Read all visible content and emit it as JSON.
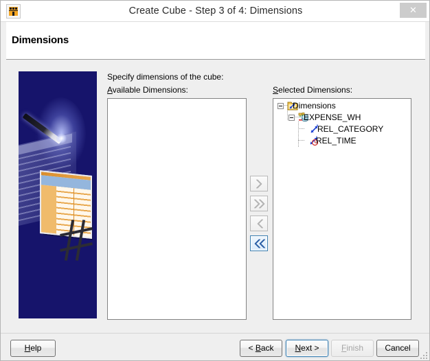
{
  "window": {
    "title": "Create Cube - Step 3 of 4: Dimensions",
    "app_icon": "cube-wizard-icon",
    "close_label": "✕"
  },
  "header": {
    "title": "Dimensions"
  },
  "main": {
    "instruction": "Specify dimensions of the cube:",
    "available_label_prefix": "A",
    "available_label_rest": "vailable Dimensions:",
    "selected_label_prefix": "S",
    "selected_label_rest": "elected Dimensions:",
    "available_items": []
  },
  "tree": {
    "root": {
      "label": "Dimensions",
      "icon": "folder-link-icon",
      "expanded": true
    },
    "cube": {
      "label": "EXPENSE_WH",
      "icon": "cube-database-icon",
      "expanded": true
    },
    "children": [
      {
        "label": "REL_CATEGORY",
        "icon": "relation-arrows-icon"
      },
      {
        "label": "REL_TIME",
        "icon": "relation-time-icon"
      }
    ]
  },
  "transfer_buttons": [
    {
      "name": "move-right-button",
      "glyph": "›",
      "enabled": false
    },
    {
      "name": "move-all-right-button",
      "glyph": "»",
      "enabled": false
    },
    {
      "name": "move-left-button",
      "glyph": "‹",
      "enabled": false
    },
    {
      "name": "move-all-left-button",
      "glyph": "«",
      "enabled": true
    }
  ],
  "footer": {
    "help": {
      "prefix": "H",
      "mnemonic": "",
      "text_before": "",
      "label_a": "H",
      "label_b": "elp"
    },
    "back": {
      "label_a": "< ",
      "label_b": "B",
      "label_c": "ack"
    },
    "next": {
      "label_a": "N",
      "label_b": "ext >"
    },
    "finish": {
      "label_a": "F",
      "label_b": "inish"
    },
    "cancel": {
      "label_a": "Cancel"
    }
  },
  "colors": {
    "banner_bg": "#16146b",
    "accent": "#3c7fb1",
    "titlebar_bg": "#ffffff",
    "dialog_bg": "#efefef"
  }
}
